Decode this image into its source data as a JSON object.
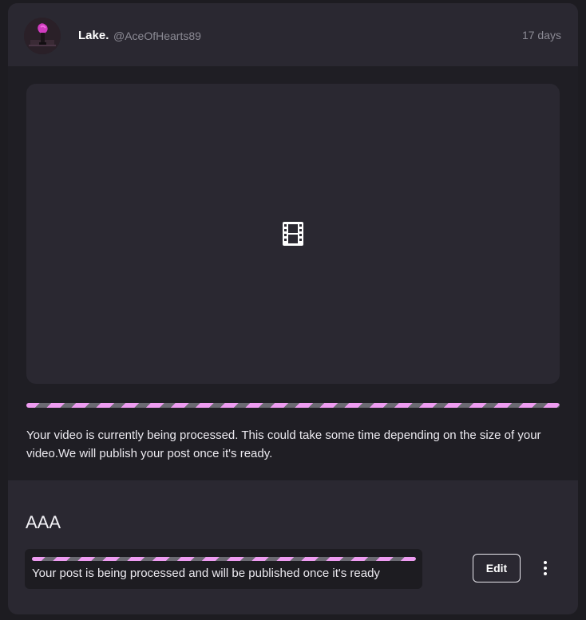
{
  "post": {
    "author": {
      "display_name": "Lake.",
      "handle": "@AceOfHearts89",
      "avatar_icon": "avatar-image"
    },
    "time_ago": "17 days",
    "media": {
      "placeholder_icon": "film-icon",
      "processing_message": "Your video is currently being processed. This could take some time depending on the size of your video.We will publish your post once it's ready."
    },
    "title": "AAA",
    "status_message": "Your post is being processed and will be published once it's ready",
    "actions": {
      "edit_label": "Edit",
      "more_icon": "more-vertical-icon"
    }
  },
  "colors": {
    "accent_pink": "#ee9cf1",
    "stripe_gray": "#6b6a72",
    "card_bg": "#2a2831",
    "page_bg": "#1d1c21"
  }
}
